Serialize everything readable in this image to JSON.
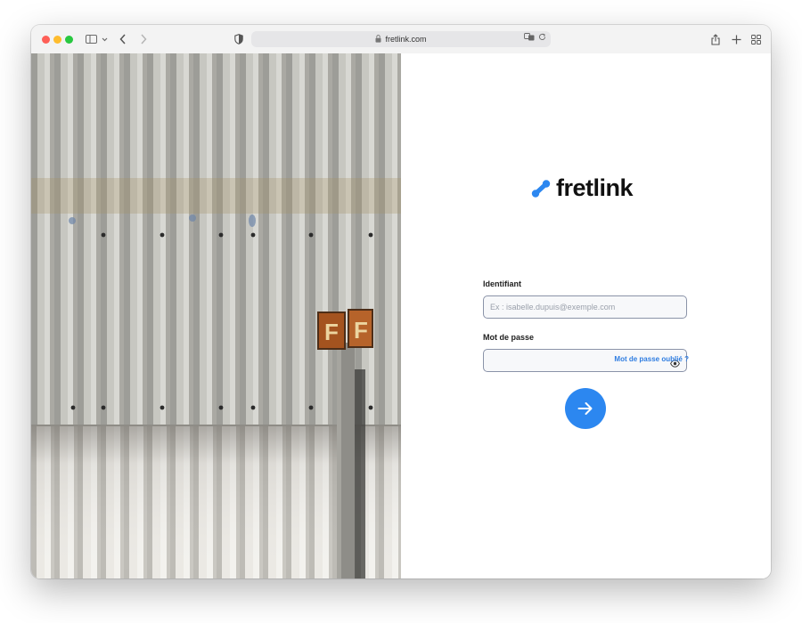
{
  "browser": {
    "url": "fretlink.com",
    "icons": [
      "sidebar-icon",
      "chevron-down-icon",
      "back-icon",
      "forward-icon",
      "shield-icon",
      "lock-icon",
      "translate-icon",
      "reload-icon",
      "share-icon",
      "new-tab-icon",
      "tab-overview-icon"
    ]
  },
  "photo": {
    "sign_letters": [
      "F",
      "F"
    ]
  },
  "login": {
    "brand": "fretlink",
    "brand_color": "#2c87f0",
    "username_label": "Identifiant",
    "username_placeholder": "Ex : isabelle.dupuis@exemple.com",
    "username_value": "",
    "password_label": "Mot de passe",
    "password_value": "",
    "forgot_link": "Mot de passe oublié ?",
    "submit_icon": "arrow-right-icon"
  }
}
